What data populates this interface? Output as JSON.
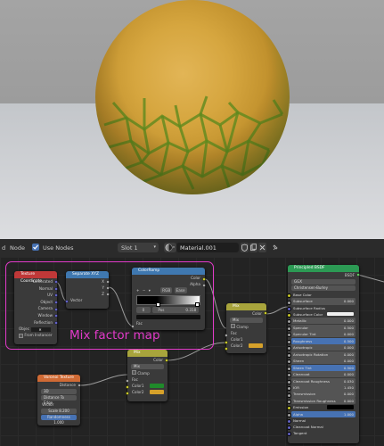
{
  "header": {
    "partial_left": "d",
    "node_menu": "Node",
    "use_nodes_label": "Use Nodes",
    "slot_label": "Slot 1",
    "material_name": "Material.001"
  },
  "annotation": "Mix factor map",
  "nodes": {
    "texture_coordinate": {
      "title": "Texture Coordinate",
      "outputs": [
        "Generated",
        "Normal",
        "UV",
        "Object",
        "Camera",
        "Window",
        "Reflection"
      ],
      "object_label": "Objec",
      "from_instancer": "From Instancer"
    },
    "separate_xyz": {
      "title": "Separate XYZ",
      "outputs": [
        "X",
        "Y",
        "Z"
      ],
      "input": "Vector"
    },
    "color_ramp": {
      "title": "ColorRamp",
      "outputs": [
        "Color",
        "Alpha"
      ],
      "mode": "RGB",
      "interp": "Ease",
      "index": "0",
      "pos_label": "Pos",
      "pos_value": "0.318",
      "input": "Fac"
    },
    "mix_top": {
      "title": "Mix",
      "output": "Color",
      "blend": "Mix",
      "clamp": "Clamp",
      "inputs": [
        "Fac",
        "Color1",
        "Color2"
      ]
    },
    "mix_bottom": {
      "title": "Mix",
      "output": "Color",
      "blend": "Mix",
      "clamp": "Clamp",
      "inputs": [
        "Fac",
        "Color1",
        "Color2"
      ],
      "color1": "#1f8a2a",
      "color2": "#d6a12a"
    },
    "voronoi": {
      "title": "Voronoi Texture",
      "output": "Distance",
      "dimensions": "3D",
      "feature": "Distance To Edge",
      "vector": "Vector",
      "scale_label": "Scale",
      "scale_value": "8.200",
      "rand_label": "Randomness",
      "rand_value": "1.000"
    },
    "bsdf": {
      "title": "Principled BSDF",
      "output": "BSDF",
      "distribution": "GGX",
      "subsurface_method": "Christensen-Burley",
      "rows": [
        {
          "label": "Base Color",
          "value": ""
        },
        {
          "label": "Subsurface",
          "value": "0.000"
        },
        {
          "label": "Subsurface Radius",
          "value": ""
        },
        {
          "label": "Subsurface Color",
          "value": ""
        },
        {
          "label": "Metallic",
          "value": "0.000"
        },
        {
          "label": "Specular",
          "value": "0.500"
        },
        {
          "label": "Specular Tint",
          "value": "0.000"
        },
        {
          "label": "Roughness",
          "value": "0.500"
        },
        {
          "label": "Anisotropic",
          "value": "0.000"
        },
        {
          "label": "Anisotropic Rotation",
          "value": "0.000"
        },
        {
          "label": "Sheen",
          "value": "0.000"
        },
        {
          "label": "Sheen Tint",
          "value": "0.500"
        },
        {
          "label": "Clearcoat",
          "value": "0.000"
        },
        {
          "label": "Clearcoat Roughness",
          "value": "0.030"
        },
        {
          "label": "IOR",
          "value": "1.450"
        },
        {
          "label": "Transmission",
          "value": "0.000"
        },
        {
          "label": "Transmission Roughness",
          "value": "0.000"
        },
        {
          "label": "Emission",
          "value": ""
        },
        {
          "label": "Alpha",
          "value": "1.000"
        },
        {
          "label": "Normal",
          "value": ""
        },
        {
          "label": "Clearcoat Normal",
          "value": ""
        },
        {
          "label": "Tangent",
          "value": ""
        }
      ]
    }
  },
  "colors": {
    "annotation": "#e23ac9",
    "texture_header": "#c03838",
    "converter_header": "#3f78b0",
    "mix_header": "#a8a43c",
    "voronoi_header": "#d06a34",
    "shader_header": "#2c9a54"
  }
}
